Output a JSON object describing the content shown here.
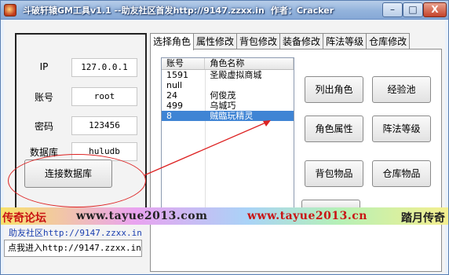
{
  "window": {
    "title": "斗破轩辕GM工具v1.1 --助友社区首发http://9147.zzxx.in",
    "author": "作者：Cracker",
    "min_symbol": "–",
    "max_symbol": "□",
    "close_symbol": "X"
  },
  "connection": {
    "ip_label": "IP",
    "ip_value": "127.0.0.1",
    "account_label": "账号",
    "account_value": "root",
    "password_label": "密码",
    "password_value": "123456",
    "database_label": "数据库",
    "database_value": "huludb",
    "connect_button": "连接数据库"
  },
  "tabs": [
    "选择角色",
    "属性修改",
    "背包修改",
    "装备修改",
    "阵法等级",
    "仓库修改"
  ],
  "character_list": {
    "columns": [
      "账号",
      "角色名称"
    ],
    "rows": [
      {
        "id": "1591",
        "name": "圣殿虚拟商城"
      },
      {
        "id": "null",
        "name": ""
      },
      {
        "id": "24",
        "name": "何俊茂"
      },
      {
        "id": "499",
        "name": "乌城巧"
      },
      {
        "id": "8",
        "name": "贼臨玩精灵",
        "selected": true
      }
    ]
  },
  "actions": {
    "list_roles": "列出角色",
    "experience": "经验池",
    "role_attributes": "角色属性",
    "formation_level": "阵法等级",
    "bag_items": "背包物品",
    "storage_items": "仓库物品"
  },
  "watermark": {
    "left": "传奇论坛",
    "url1": "www.tayue2013.com",
    "url2": "www.tayue2013.cn",
    "right": "踏月传奇"
  },
  "promo": {
    "line1": "助友社区http://9147.zzxx.in",
    "line2": "点我进入http://9147.zzxx.in"
  }
}
